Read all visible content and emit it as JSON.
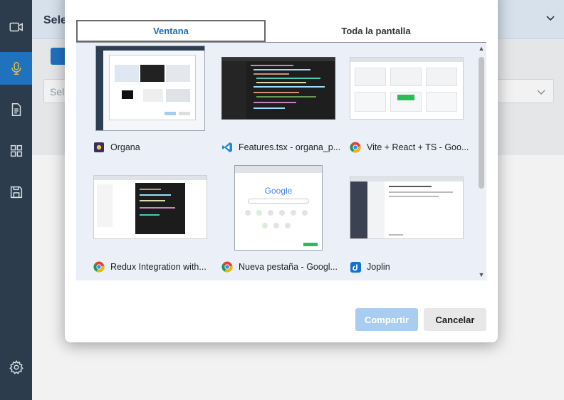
{
  "app": {
    "header_title": "Sele",
    "select_placeholder": "Sele",
    "accent_color": "#1f78c8",
    "sidebar_color": "#2d3e50"
  },
  "sidebar": {
    "icons": [
      "video-camera-icon",
      "microphone-icon",
      "document-icon",
      "grid-icon",
      "save-icon",
      "settings-icon"
    ],
    "active": "microphone-icon"
  },
  "dialog": {
    "tabs": [
      {
        "label": "Ventana",
        "selected": true
      },
      {
        "label": "Toda la pantalla",
        "selected": false
      }
    ],
    "windows": [
      {
        "label": "Organa",
        "icon": "organa-app-icon"
      },
      {
        "label": "Features.tsx - organa_p...",
        "icon": "vscode-icon"
      },
      {
        "label": "Vite + React + TS - Goo...",
        "icon": "chrome-icon"
      },
      {
        "label": "Redux Integration with...",
        "icon": "chrome-icon"
      },
      {
        "label": "Nueva pestaña - Googl...",
        "icon": "chrome-icon",
        "thumb_text": "Google"
      },
      {
        "label": "Joplin",
        "icon": "joplin-icon"
      }
    ],
    "buttons": {
      "share_label": "Compartir",
      "cancel_label": "Cancelar"
    }
  }
}
